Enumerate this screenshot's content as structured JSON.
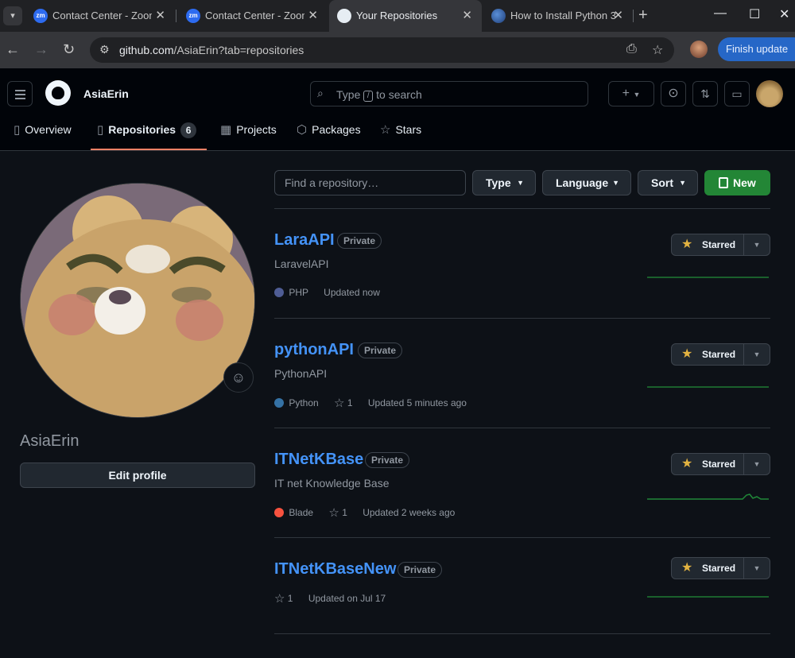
{
  "browser": {
    "tabs": [
      {
        "title": "Contact Center - Zoom",
        "favicon": "zoom-icon",
        "active": false
      },
      {
        "title": "Contact Center - Zoom",
        "favicon": "zoom-icon",
        "active": false
      },
      {
        "title": "Your Repositories",
        "favicon": "github-icon",
        "active": true
      },
      {
        "title": "How to Install Python 3",
        "favicon": "globe-icon",
        "active": false
      }
    ],
    "url_host": "github.com",
    "url_path": "/AsiaErin?tab=repositories",
    "finish_update": "Finish update",
    "zoom_favicon_text": "zm"
  },
  "header": {
    "username": "AsiaErin",
    "search_prefix": "Type",
    "search_kbd": "/",
    "search_suffix": "to search"
  },
  "nav": {
    "overview": "Overview",
    "repositories": "Repositories",
    "repositories_count": "6",
    "projects": "Projects",
    "packages": "Packages",
    "stars": "Stars"
  },
  "profile": {
    "name": "AsiaErin",
    "edit_label": "Edit profile"
  },
  "controls": {
    "find_placeholder": "Find a repository…",
    "type_label": "Type",
    "language_label": "Language",
    "sort_label": "Sort",
    "new_label": "New"
  },
  "repos": [
    {
      "name": "LaraAPI",
      "visibility": "Private",
      "description": "LaravelAPI",
      "language": "PHP",
      "lang_color": "#4F5D95",
      "stars": "",
      "updated": "Updated now",
      "starred_label": "Starred"
    },
    {
      "name": "pythonAPI",
      "visibility": "Private",
      "description": "PythonAPI",
      "language": "Python",
      "lang_color": "#3572A5",
      "stars": "1",
      "updated": "Updated 5 minutes ago",
      "starred_label": "Starred"
    },
    {
      "name": "ITNetKBase",
      "visibility": "Private",
      "description": "IT net Knowledge Base",
      "language": "Blade",
      "lang_color": "#f7523f",
      "stars": "1",
      "updated": "Updated 2 weeks ago",
      "starred_label": "Starred"
    },
    {
      "name": "ITNetKBaseNew",
      "visibility": "Private",
      "description": "",
      "language": "",
      "lang_color": "",
      "stars": "1",
      "updated": "Updated on Jul 17",
      "starred_label": "Starred"
    }
  ],
  "colors": {
    "accent_link": "#4493f8",
    "new_button": "#238636",
    "star": "#e3b341",
    "nav_underline": "#f78166"
  }
}
